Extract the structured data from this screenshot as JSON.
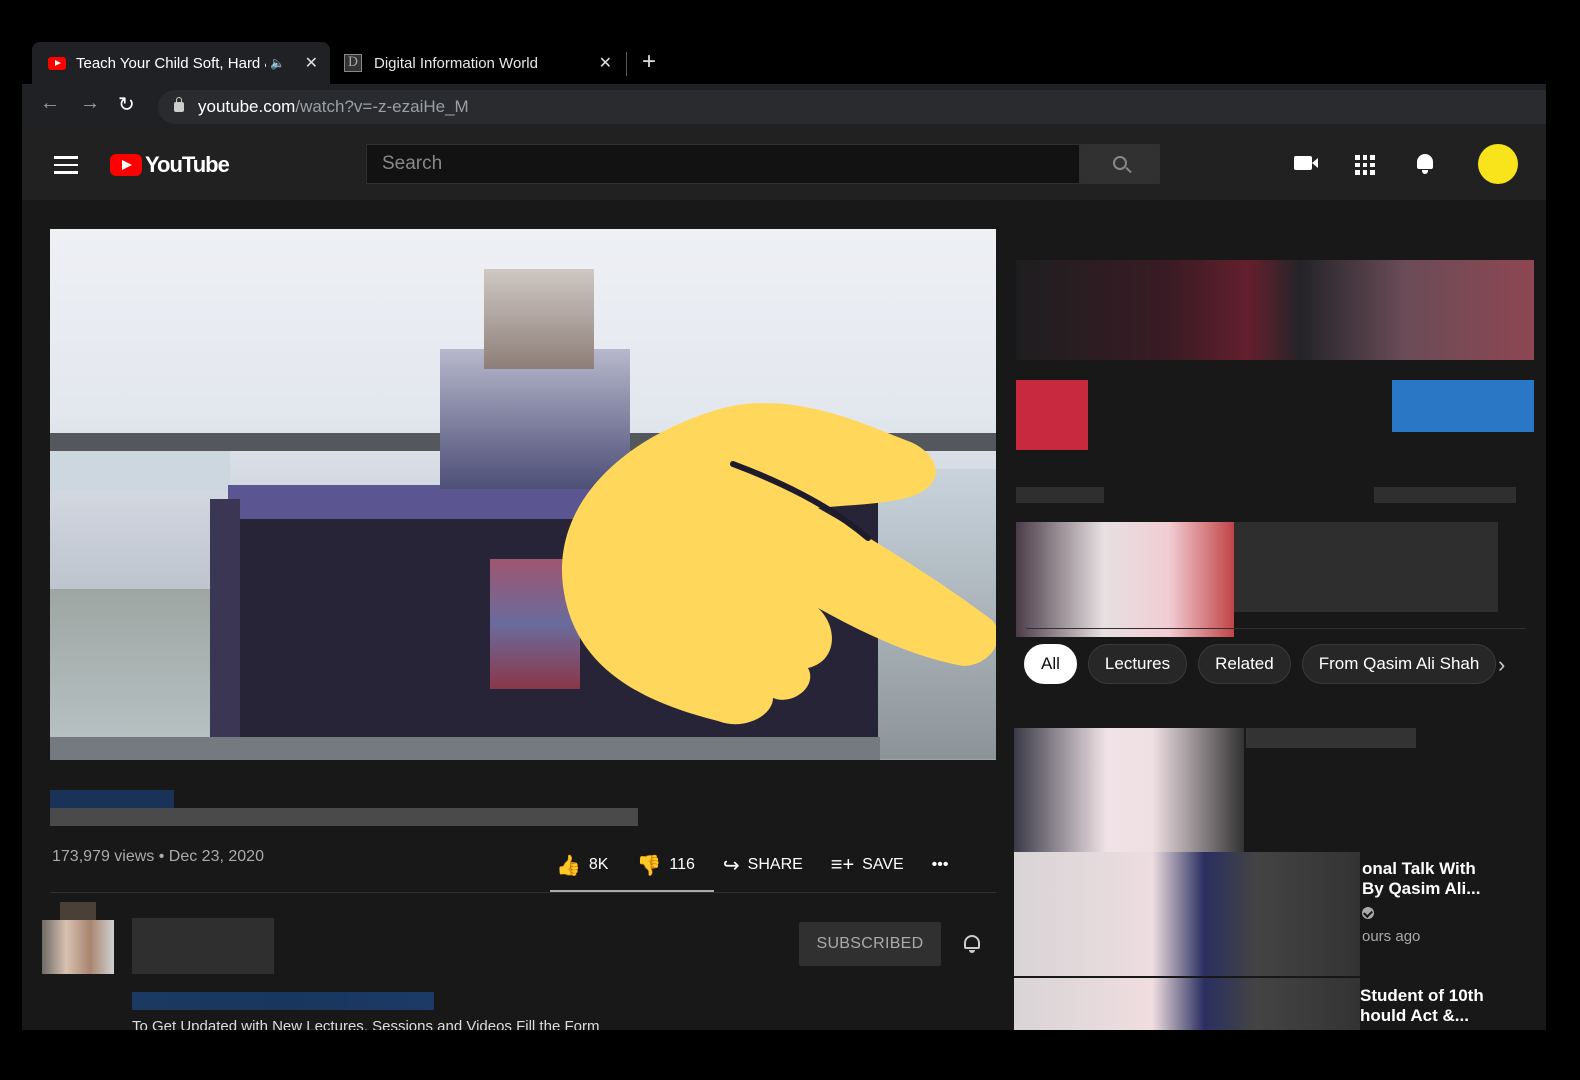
{
  "browser": {
    "tabs": [
      {
        "title": "Teach Your Child Soft, Hard &",
        "active": true,
        "favicon": "youtube-icon",
        "close": "✕"
      },
      {
        "title": "Digital Information World",
        "active": false,
        "favicon": "D",
        "close": "✕"
      }
    ],
    "new_tab": "+",
    "url_domain": "youtube.com",
    "url_path": "/watch?v=-z-ezaiHe_M"
  },
  "header": {
    "logo_text": "YouTube",
    "search_placeholder": "Search"
  },
  "video": {
    "meta": "173,979 views • Dec 23, 2020",
    "likes": "8K",
    "dislikes": "116",
    "share_label": "SHARE",
    "save_label": "SAVE",
    "more_label": "•••",
    "subscribed_label": "SUBSCRIBED",
    "description_line": "To Get Updated with New Lectures, Sessions and Videos Fill the Form"
  },
  "sidebar": {
    "chips": [
      "All",
      "Lectures",
      "Related",
      "From Qasim Ali Shah"
    ],
    "recommendations": [
      {
        "title_line1": "onal Talk With",
        "title_line2": "By Qasim Ali...",
        "meta": "ours ago"
      },
      {
        "title_line1": "Student of 10th",
        "title_line2": "hould Act &..."
      }
    ]
  },
  "colors": {
    "youtube_red": "#ff0000",
    "avatar_yellow": "#f9e41b",
    "pointer_yellow": "#ffd75a",
    "page_bg": "#181818"
  }
}
